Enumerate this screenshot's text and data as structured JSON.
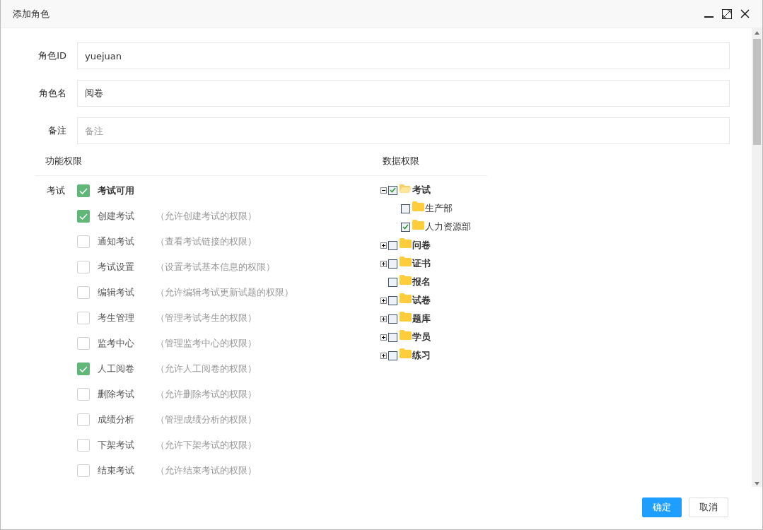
{
  "window": {
    "title": "添加角色"
  },
  "fields": [
    {
      "label": "角色ID",
      "value": "yuejuan"
    },
    {
      "label": "角色名",
      "value": "阅卷"
    },
    {
      "label": "备注",
      "placeholder": "备注"
    }
  ],
  "function_permissions": {
    "heading": "功能权限",
    "group": "考试",
    "items": [
      {
        "kind": "master",
        "label": "考试可用",
        "checked": true
      },
      {
        "kind": "item",
        "label": "创建考试",
        "description": "（允许创建考试的权限）",
        "checked": true
      },
      {
        "kind": "item",
        "label": "通知考试",
        "description": "（查看考试链接的权限）",
        "checked": false
      },
      {
        "kind": "item",
        "label": "考试设置",
        "description": "（设置考试基本信息的权限）",
        "checked": false
      },
      {
        "kind": "item",
        "label": "编辑考试",
        "description": "（允许编辑考试更新试题的权限）",
        "checked": false
      },
      {
        "kind": "item",
        "label": "考生管理",
        "description": "（管理考试考生的权限）",
        "checked": false
      },
      {
        "kind": "item",
        "label": "监考中心",
        "description": "（管理监考中心的权限）",
        "checked": false
      },
      {
        "kind": "item",
        "label": "人工阅卷",
        "description": "（允许人工阅卷的权限）",
        "checked": true
      },
      {
        "kind": "item",
        "label": "删除考试",
        "description": "（允许删除考试的权限）",
        "checked": false
      },
      {
        "kind": "item",
        "label": "成绩分析",
        "description": "（管理成绩分析的权限）",
        "checked": false
      },
      {
        "kind": "item",
        "label": "下架考试",
        "description": "（允许下架考试的权限）",
        "checked": false
      },
      {
        "kind": "item",
        "label": "结束考试",
        "description": "（允许结束考试的权限）",
        "checked": false
      }
    ]
  },
  "data_permissions": {
    "heading": "数据权限",
    "tree": [
      {
        "label": "考试",
        "checked": true,
        "expanded": true,
        "children": [
          {
            "label": "生产部",
            "checked": false
          },
          {
            "label": "人力资源部",
            "checked": true
          }
        ]
      },
      {
        "label": "问卷",
        "checked": false,
        "expanded": false
      },
      {
        "label": "证书",
        "checked": false,
        "expanded": false
      },
      {
        "label": "报名",
        "checked": false
      },
      {
        "label": "试卷",
        "checked": false,
        "expanded": false
      },
      {
        "label": "题库",
        "checked": false,
        "expanded": false
      },
      {
        "label": "学员",
        "checked": false,
        "expanded": false
      },
      {
        "label": "练习",
        "checked": false,
        "expanded": false
      }
    ]
  },
  "buttons": [
    {
      "kind": "primary",
      "label": "确定"
    },
    {
      "kind": "default",
      "label": "取消"
    }
  ]
}
